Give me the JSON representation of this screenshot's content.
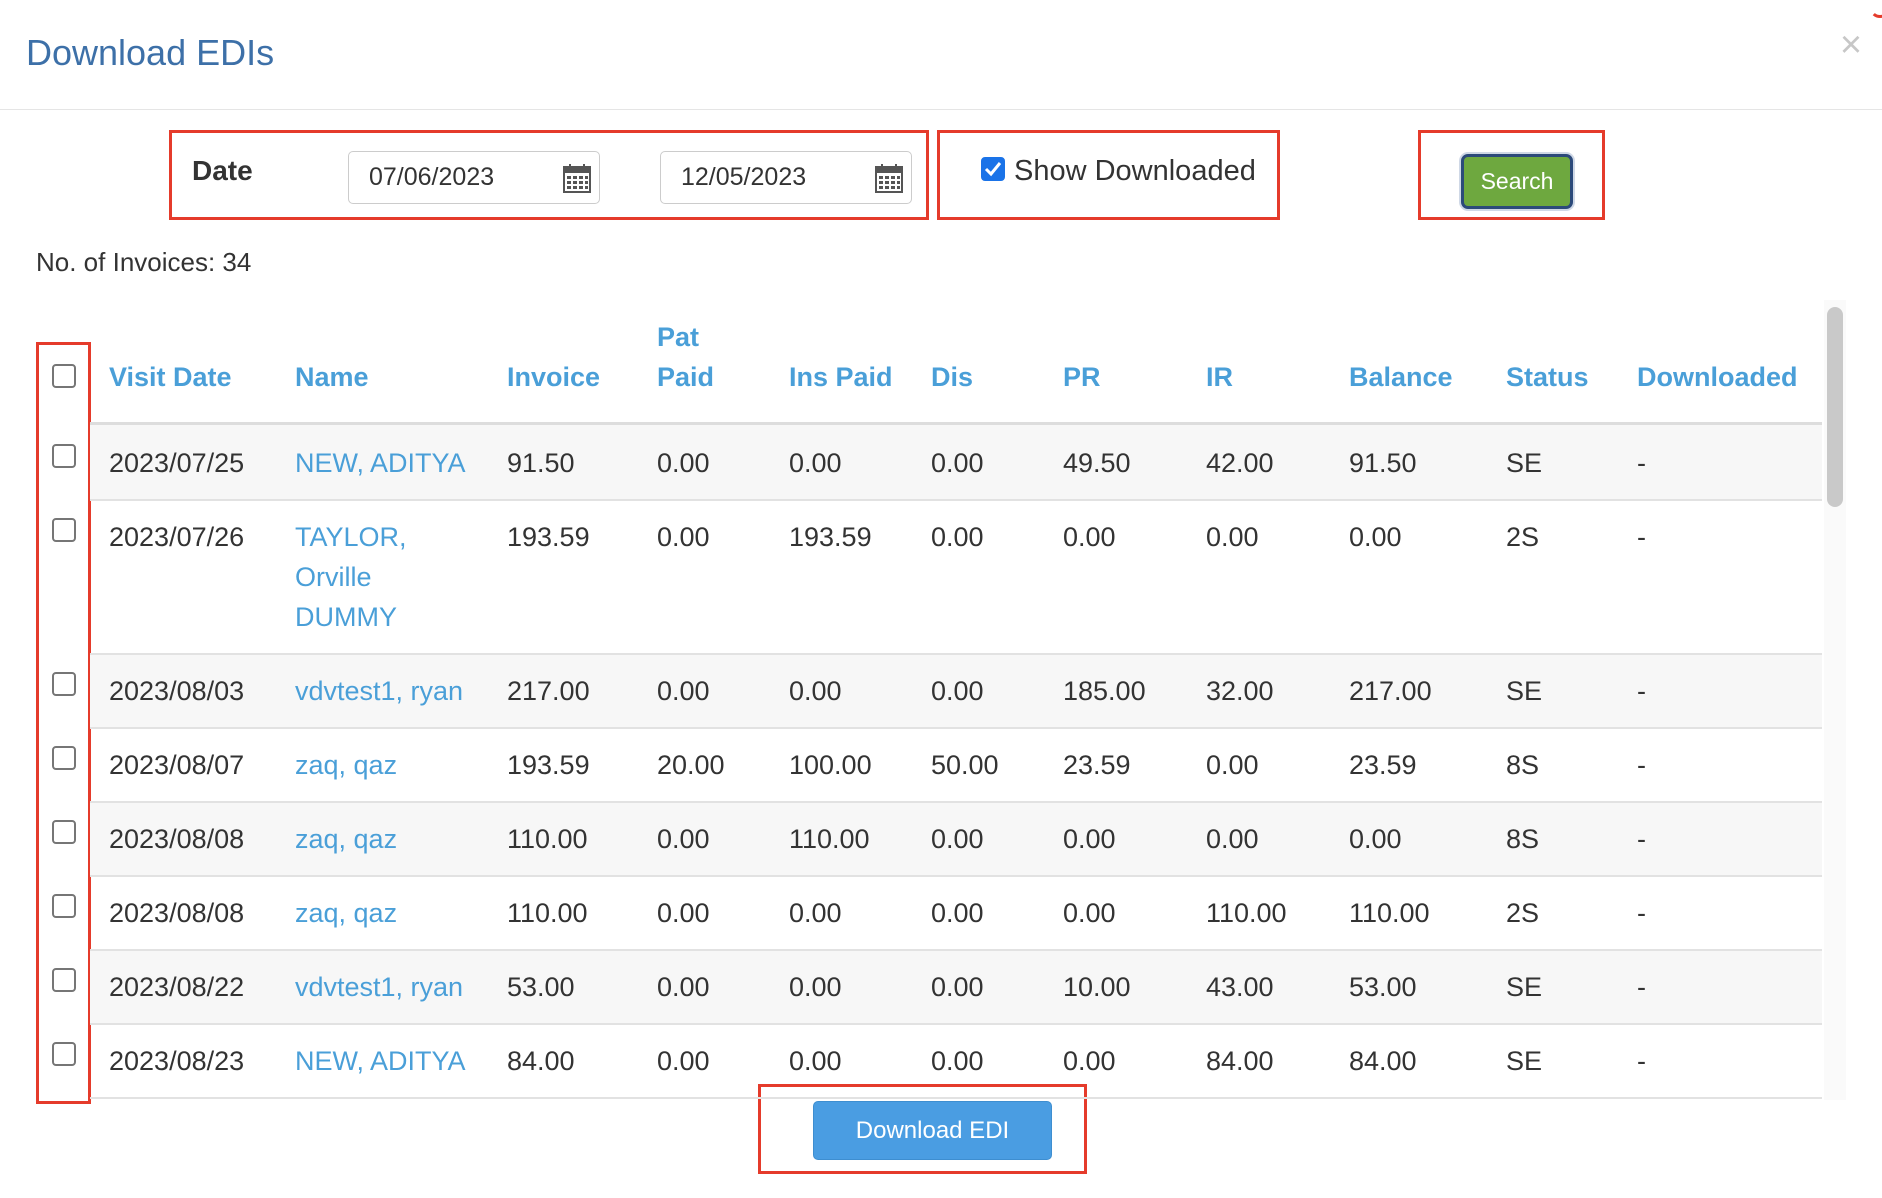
{
  "modal": {
    "title": "Download EDIs",
    "close_glyph": "×",
    "close_icon": "close-icon"
  },
  "filters": {
    "date_label": "Date",
    "date_from": "07/06/2023",
    "date_to": "12/05/2023",
    "calendar_icon": "calendar-icon",
    "show_downloaded_checked": true,
    "show_downloaded_label": "Show Downloaded",
    "search_label": "Search"
  },
  "invoice_count_text": "No. of Invoices: 34",
  "table": {
    "headers": {
      "visit_date": "Visit Date",
      "name": "Name",
      "invoice": "Invoice",
      "pat_paid_line1": "Pat",
      "pat_paid_line2": "Paid",
      "ins_paid": "Ins Paid",
      "dis": "Dis",
      "pr": "PR",
      "ir": "IR",
      "balance": "Balance",
      "status": "Status",
      "downloaded": "Downloaded"
    },
    "rows": [
      {
        "visit_date": "2023/07/25",
        "name_lines": [
          "NEW, ADITYA"
        ],
        "invoice": "91.50",
        "pat_paid": "0.00",
        "ins_paid": "0.00",
        "dis": "0.00",
        "pr": "49.50",
        "ir": "42.00",
        "balance": "91.50",
        "status": "SE",
        "downloaded": "-"
      },
      {
        "visit_date": "2023/07/26",
        "name_lines": [
          "TAYLOR,",
          "Orville",
          "DUMMY"
        ],
        "invoice": "193.59",
        "pat_paid": "0.00",
        "ins_paid": "193.59",
        "dis": "0.00",
        "pr": "0.00",
        "ir": "0.00",
        "balance": "0.00",
        "status": "2S",
        "downloaded": "-"
      },
      {
        "visit_date": "2023/08/03",
        "name_lines": [
          "vdvtest1, ryan"
        ],
        "invoice": "217.00",
        "pat_paid": "0.00",
        "ins_paid": "0.00",
        "dis": "0.00",
        "pr": "185.00",
        "ir": "32.00",
        "balance": "217.00",
        "status": "SE",
        "downloaded": "-"
      },
      {
        "visit_date": "2023/08/07",
        "name_lines": [
          "zaq, qaz"
        ],
        "invoice": "193.59",
        "pat_paid": "20.00",
        "ins_paid": "100.00",
        "dis": "50.00",
        "pr": "23.59",
        "ir": "0.00",
        "balance": "23.59",
        "status": "8S",
        "downloaded": "-"
      },
      {
        "visit_date": "2023/08/08",
        "name_lines": [
          "zaq, qaz"
        ],
        "invoice": "110.00",
        "pat_paid": "0.00",
        "ins_paid": "110.00",
        "dis": "0.00",
        "pr": "0.00",
        "ir": "0.00",
        "balance": "0.00",
        "status": "8S",
        "downloaded": "-"
      },
      {
        "visit_date": "2023/08/08",
        "name_lines": [
          "zaq, qaz"
        ],
        "invoice": "110.00",
        "pat_paid": "0.00",
        "ins_paid": "0.00",
        "dis": "0.00",
        "pr": "0.00",
        "ir": "110.00",
        "balance": "110.00",
        "status": "2S",
        "downloaded": "-"
      },
      {
        "visit_date": "2023/08/22",
        "name_lines": [
          "vdvtest1, ryan"
        ],
        "invoice": "53.00",
        "pat_paid": "0.00",
        "ins_paid": "0.00",
        "dis": "0.00",
        "pr": "10.00",
        "ir": "43.00",
        "balance": "53.00",
        "status": "SE",
        "downloaded": "-"
      },
      {
        "visit_date": "2023/08/23",
        "name_lines": [
          "NEW, ADITYA"
        ],
        "invoice": "84.00",
        "pat_paid": "0.00",
        "ins_paid": "0.00",
        "dis": "0.00",
        "pr": "0.00",
        "ir": "84.00",
        "balance": "84.00",
        "status": "SE",
        "downloaded": "-"
      }
    ]
  },
  "download_button_label": "Download EDI",
  "colors": {
    "title": "#3d70a8",
    "link": "#4a9fd8",
    "annotation_red": "#e53b2b",
    "search_green": "#6ea83f",
    "download_blue": "#4a9de2"
  }
}
